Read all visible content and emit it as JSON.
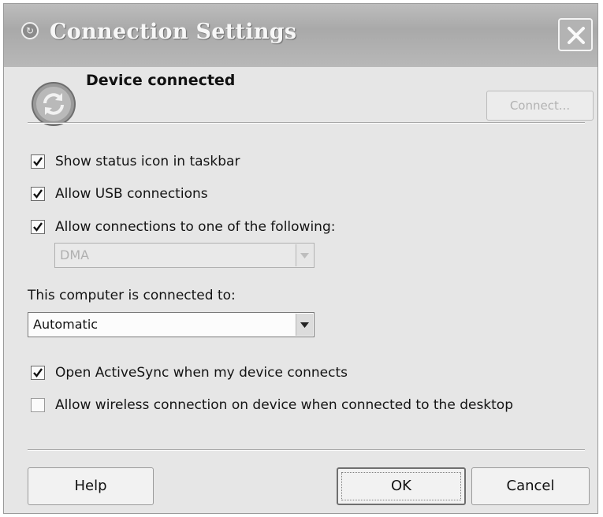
{
  "window": {
    "title": "Connection Settings",
    "close_icon": "close-icon",
    "app_icon": "activesync-icon"
  },
  "status": {
    "heading": "Device connected",
    "icon": "sync-arrows-icon",
    "connect_label": "Connect..."
  },
  "options": {
    "show_status_icon": {
      "label": "Show status icon in taskbar",
      "checked": true
    },
    "allow_usb": {
      "label": "Allow USB connections",
      "checked": true
    },
    "allow_one_of": {
      "label": "Allow connections to one of the following:",
      "checked": true
    },
    "connection_type": {
      "value": "DMA",
      "disabled": true
    }
  },
  "connected_to": {
    "label": "This computer is connected to:",
    "value": "Automatic"
  },
  "sync": {
    "open_activesync": {
      "label": "Open ActiveSync when my device connects",
      "checked": true
    },
    "allow_wireless": {
      "label": "Allow wireless connection on device when connected to the desktop",
      "checked": false
    }
  },
  "buttons": {
    "help": "Help",
    "ok": "OK",
    "cancel": "Cancel"
  },
  "colors": {
    "dialog_bg": "#e6e6e6",
    "titlebar": "#b0b0b0",
    "disabled_text": "#b2b2b2"
  }
}
